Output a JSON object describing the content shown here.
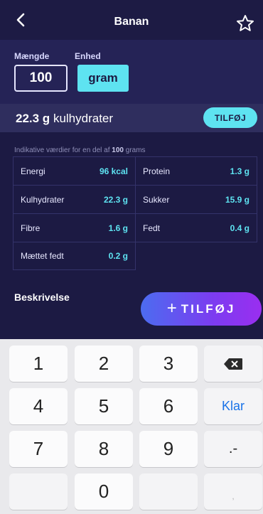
{
  "header": {
    "title": "Banan"
  },
  "quantity": {
    "amount_label": "Mængde",
    "unit_label": "Enhed",
    "amount_value": "100",
    "unit_value": "gram"
  },
  "summary": {
    "value": "22.3 g",
    "label": "kulhydrater",
    "add_label": "TILFØJ"
  },
  "hint": {
    "prefix": "Indikative værdier for en del af ",
    "amount": "100",
    "suffix": " grams"
  },
  "nutrients": [
    {
      "name": "Energi",
      "value": "96 kcal"
    },
    {
      "name": "Protein",
      "value": "1.3 g"
    },
    {
      "name": "Kulhydrater",
      "value": "22.3 g"
    },
    {
      "name": "Sukker",
      "value": "15.9 g"
    },
    {
      "name": "Fibre",
      "value": "1.6 g"
    },
    {
      "name": "Fedt",
      "value": "0.4 g"
    },
    {
      "name": "Mættet fedt",
      "value": "0.2 g"
    }
  ],
  "description": {
    "label": "Beskrivelse"
  },
  "add_button": {
    "icon": "plus-icon",
    "label": "TILFØJ"
  },
  "keyboard": {
    "keys": [
      "1",
      "2",
      "3",
      "4",
      "5",
      "6",
      "7",
      "8",
      "9",
      "0"
    ],
    "done_label": "Klar",
    "separator_label": ".-",
    "comma_label": ","
  },
  "colors": {
    "background": "#1c1a43",
    "accent": "#5ee3f1",
    "gradient_start": "#4c6cf0",
    "gradient_end": "#9a2ef0"
  }
}
